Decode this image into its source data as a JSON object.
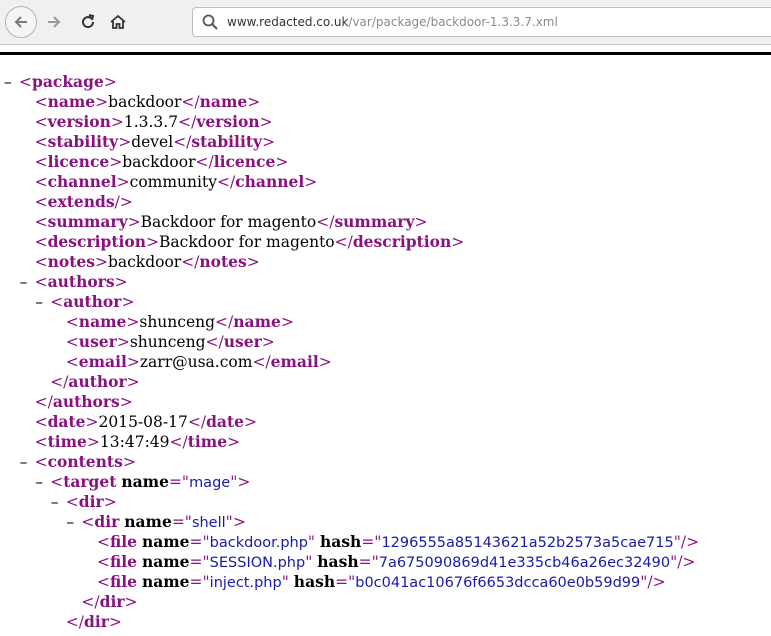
{
  "browser": {
    "url_domain": "www.redacted.co.uk",
    "url_path": "/var/package/backdoor-1.3.3.7.xml"
  },
  "xml_lines": [
    {
      "indent": 0,
      "tog": true,
      "open": "package"
    },
    {
      "indent": 1,
      "open": "name",
      "text": "backdoor",
      "close": "name"
    },
    {
      "indent": 1,
      "open": "version",
      "text": "1.3.3.7",
      "close": "version"
    },
    {
      "indent": 1,
      "open": "stability",
      "text": "devel",
      "close": "stability"
    },
    {
      "indent": 1,
      "open": "licence",
      "text": "backdoor",
      "close": "licence"
    },
    {
      "indent": 1,
      "open": "channel",
      "text": "community",
      "close": "channel"
    },
    {
      "indent": 1,
      "selfclose": "extends"
    },
    {
      "indent": 1,
      "open": "summary",
      "text": "Backdoor for magento",
      "close": "summary"
    },
    {
      "indent": 1,
      "open": "description",
      "text": "Backdoor for magento",
      "close": "description"
    },
    {
      "indent": 1,
      "open": "notes",
      "text": "backdoor",
      "close": "notes"
    },
    {
      "indent": 1,
      "tog": true,
      "open": "authors"
    },
    {
      "indent": 2,
      "tog": true,
      "open": "author"
    },
    {
      "indent": 3,
      "open": "name",
      "text": "shunceng",
      "close": "name"
    },
    {
      "indent": 3,
      "open": "user",
      "text": "shunceng",
      "close": "user"
    },
    {
      "indent": 3,
      "open": "email",
      "text": "zarr@usa.com",
      "close": "email"
    },
    {
      "indent": 2,
      "endtag": "author"
    },
    {
      "indent": 1,
      "endtag": "authors"
    },
    {
      "indent": 1,
      "open": "date",
      "text": "2015-08-17",
      "close": "date"
    },
    {
      "indent": 1,
      "open": "time",
      "text": "13:47:49",
      "close": "time"
    },
    {
      "indent": 1,
      "tog": true,
      "open": "contents"
    },
    {
      "indent": 2,
      "tog": true,
      "open": "target",
      "attrs": [
        {
          "name": "name",
          "value": "mage"
        }
      ]
    },
    {
      "indent": 3,
      "tog": true,
      "open": "dir"
    },
    {
      "indent": 4,
      "tog": true,
      "open": "dir",
      "attrs": [
        {
          "name": "name",
          "value": "shell"
        }
      ]
    },
    {
      "indent": 5,
      "open": "file",
      "attrs": [
        {
          "name": "name",
          "value": "backdoor.php"
        },
        {
          "name": "hash",
          "value": "1296555a85143621a52b2573a5cae715"
        }
      ],
      "selfend": true
    },
    {
      "indent": 5,
      "open": "file",
      "attrs": [
        {
          "name": "name",
          "value": "SESSION.php"
        },
        {
          "name": "hash",
          "value": "7a675090869d41e335cb46a26ec32490"
        }
      ],
      "selfend": true
    },
    {
      "indent": 5,
      "open": "file",
      "attrs": [
        {
          "name": "name",
          "value": "inject.php"
        },
        {
          "name": "hash",
          "value": "b0c041ac10676f6653dcca60e0b59d99"
        }
      ],
      "selfend": true
    },
    {
      "indent": 4,
      "endtag": "dir"
    },
    {
      "indent": 3,
      "endtag": "dir"
    }
  ]
}
